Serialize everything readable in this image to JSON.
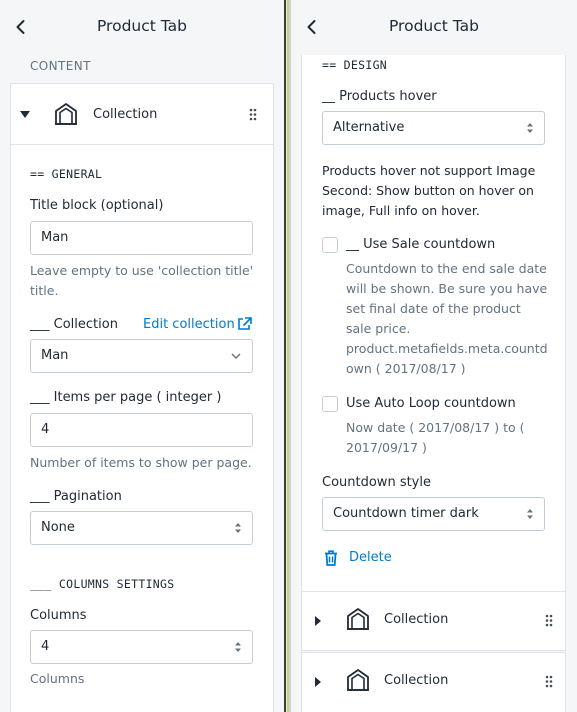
{
  "left": {
    "header": {
      "title": "Product Tab"
    },
    "section": "CONTENT",
    "block": {
      "name": "Collection"
    },
    "general_heading": "== GENERAL",
    "title_block": {
      "label": "Title block (optional)",
      "value": "Man",
      "help_line1": "Leave empty to use 'collection title'",
      "help_line2": "title."
    },
    "collection": {
      "label": "___ Collection",
      "edit_link": "Edit collection",
      "value": "Man"
    },
    "items_per_page": {
      "label": "___ Items per page ( integer )",
      "value": "4",
      "help": "Number of items to show per page."
    },
    "pagination": {
      "label": "___ Pagination",
      "value": "None"
    },
    "columns_heading": "___ COLUMNS SETTINGS",
    "columns": {
      "label": "Columns",
      "value": "4",
      "help": "Columns"
    }
  },
  "right": {
    "header": {
      "title": "Product Tab"
    },
    "design_heading": "== DESIGN",
    "products_hover": {
      "label": "__ Products hover",
      "value": "Alternative"
    },
    "hover_note": [
      "Products hover not support Image",
      "Second: Show button on hover on",
      "image, Full info on hover."
    ],
    "sale_countdown": {
      "label": "__ Use Sale countdown",
      "checked": false,
      "help": [
        "Countdown to the end sale date",
        "will be shown. Be sure you have",
        "set final date of the product",
        "sale price.",
        "product.metafields.meta.countd",
        "own ( 2017/08/17 )"
      ]
    },
    "auto_loop": {
      "label": "Use Auto Loop countdown",
      "checked": false,
      "help": [
        "Now date ( 2017/08/17 ) to (",
        "2017/09/17 )"
      ]
    },
    "countdown_style": {
      "label": "Countdown style",
      "value": "Countdown timer dark"
    },
    "delete_label": "Delete",
    "blocks": [
      {
        "name": "Collection"
      },
      {
        "name": "Collection"
      }
    ]
  },
  "colors": {
    "link": "#007ace",
    "text": "#212b36",
    "muted": "#637381",
    "border": "#c4cdd5"
  },
  "icons": [
    "chevron-left-icon",
    "caret-down-icon",
    "caret-right-icon",
    "collection-icon",
    "drag-handle-icon",
    "external-link-icon",
    "select-arrows-icon",
    "chevron-down-icon",
    "trash-icon"
  ]
}
